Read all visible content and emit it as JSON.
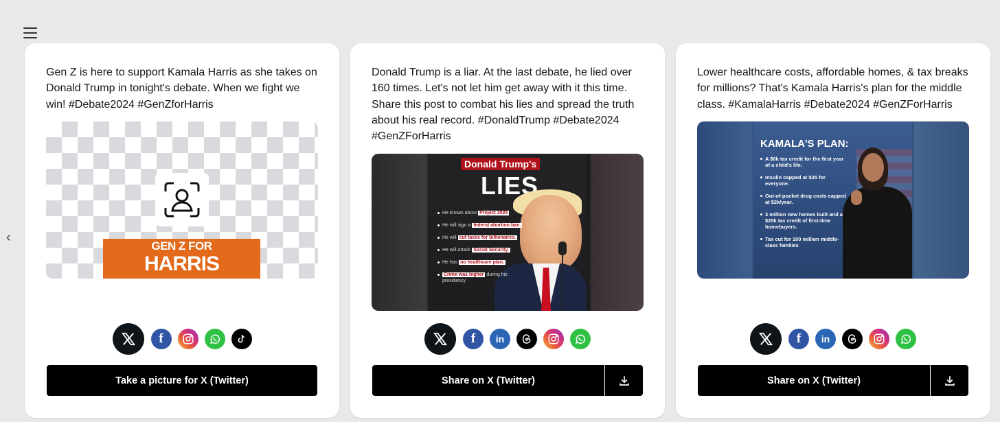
{
  "nav": {
    "menu_icon": "hamburger-menu-icon",
    "prev_icon": "chevron-left-icon",
    "prev_glyph": "‹"
  },
  "cards": [
    {
      "text": "Gen Z is here to support Kamala Harris as she takes on Donald Trump in tonight's debate. When we fight we win! #Debate2024 #GenZforHarris",
      "banner_line1": "GEN Z FOR",
      "banner_line2": "HARRIS",
      "socials": [
        "x",
        "facebook",
        "instagram",
        "whatsapp",
        "tiktok"
      ],
      "button": "Take a picture for X (Twitter)"
    },
    {
      "text": "Donald Trump is a liar. At the last debate, he lied over 160 times. Let's not let him get away with it this time. Share this post to combat his lies and spread the truth about his real record. #DonaldTrump #Debate2024 #GenZForHarris",
      "image": {
        "title_top": "Donald Trump's",
        "title_main": "LIES",
        "bullets": [
          {
            "pre": "He knows about ",
            "hl": "Project 2025",
            "post": ""
          },
          {
            "pre": "He will sign a ",
            "hl": "federal abortion ban.",
            "post": ""
          },
          {
            "pre": "He will ",
            "hl": "cut taxes for billionaires.",
            "post": ""
          },
          {
            "pre": "He will attack ",
            "hl": "Social Security.",
            "post": ""
          },
          {
            "pre": "He has ",
            "hl": "no healthcare plan.",
            "post": ""
          },
          {
            "pre": "",
            "hl": "Crime was higher",
            "post": " during his presidency."
          }
        ]
      },
      "socials": [
        "x",
        "facebook",
        "linkedin",
        "threads",
        "instagram",
        "whatsapp"
      ],
      "button": "Share on X (Twitter)"
    },
    {
      "text": "Lower healthcare costs, affordable homes, & tax breaks for millions? That's Kamala Harris's plan for the middle class. #KamalaHarris #Debate2024 #GenZForHarris",
      "image": {
        "title": "KAMALA'S PLAN:",
        "bullets": [
          "A $6k tax credit for the first year of a child's life.",
          "Insulin capped at $35 for everyone.",
          "Out-of-pocket drug costs capped at $2k/year.",
          "3 million new homes built and a $25k tax credit of first-time homebuyers.",
          "Tax cut for 100 million middle-class families"
        ]
      },
      "socials": [
        "x",
        "facebook",
        "linkedin",
        "threads",
        "instagram",
        "whatsapp"
      ],
      "button": "Share on X (Twitter)"
    }
  ],
  "social_glyphs": {
    "x": "X",
    "facebook": "f",
    "linkedin": "in"
  }
}
